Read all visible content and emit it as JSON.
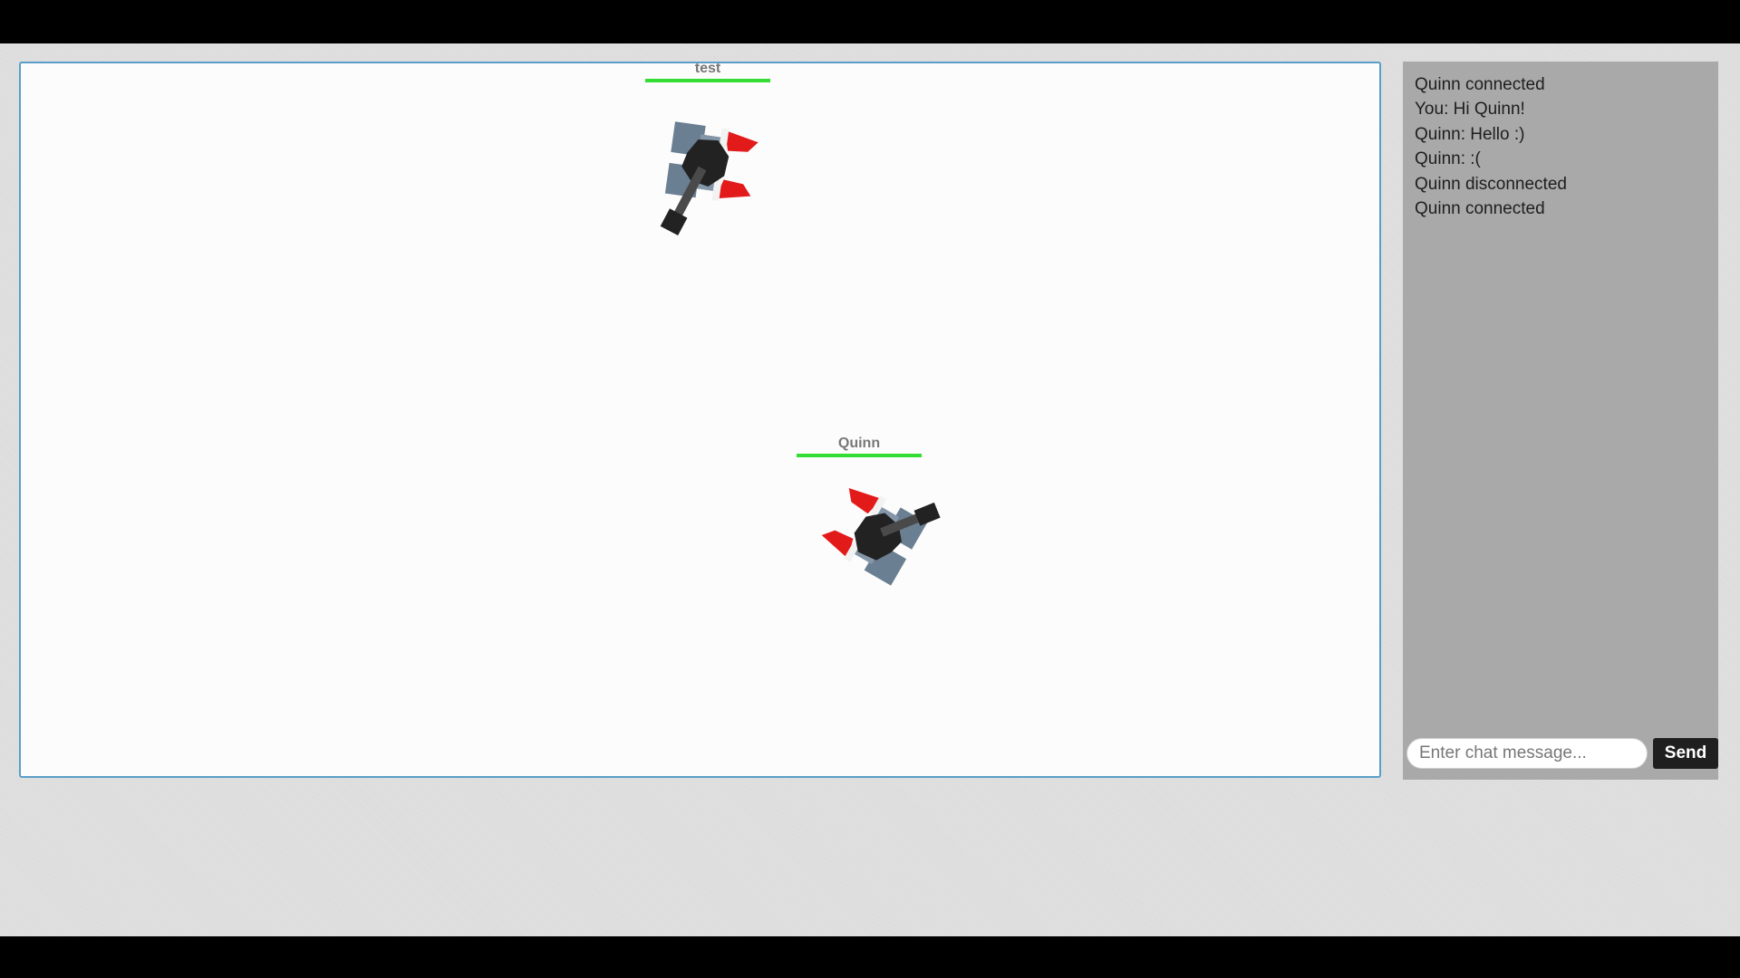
{
  "game": {
    "players": [
      {
        "name": "test",
        "health": 1.0
      },
      {
        "name": "Quinn",
        "health": 1.0
      }
    ],
    "colors": {
      "canvas_background": "#fcfcfc",
      "canvas_border": "#5a9ec8",
      "health_bar": "#33dd33",
      "tank_body": "#6b7f92",
      "tank_core": "#222222",
      "tank_accent": "#e31a1a",
      "turret_barrel": "#4a4a4a",
      "turret_tip": "#222222"
    }
  },
  "chat": {
    "messages": [
      "Quinn connected",
      "You: Hi Quinn!",
      "Quinn: Hello :)",
      "Quinn: :(",
      "Quinn disconnected",
      "Quinn connected"
    ],
    "input_placeholder": "Enter chat message...",
    "send_label": "Send"
  }
}
